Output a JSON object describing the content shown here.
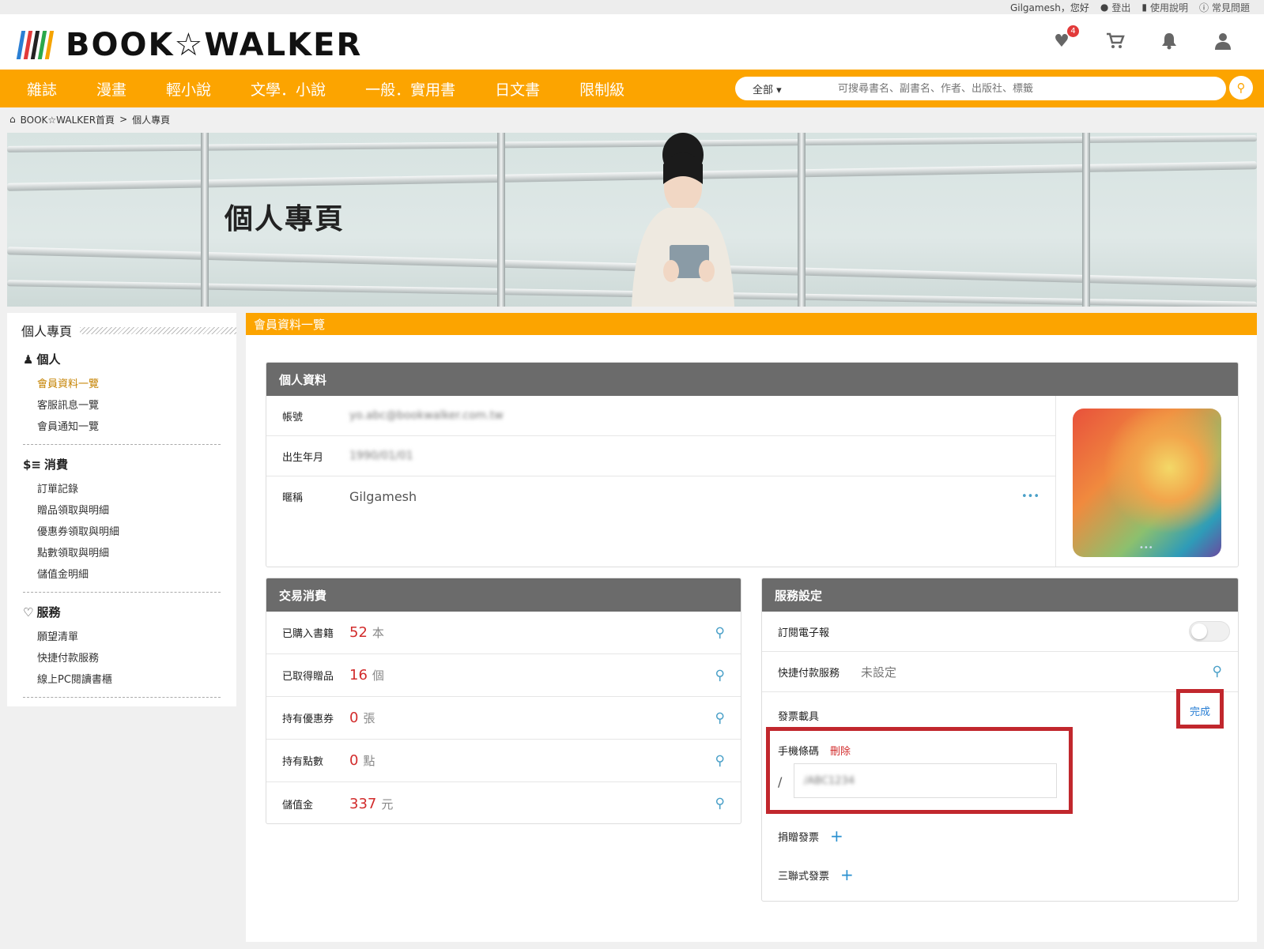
{
  "topbar": {
    "greeting": "Gilgamesh，您好",
    "logout": "登出",
    "usage": "使用說明",
    "faq": "常見問題"
  },
  "logo": {
    "text": "BOOK☆WALKER"
  },
  "header": {
    "wishlist_count": "4"
  },
  "nav": {
    "items": [
      "雜誌",
      "漫畫",
      "輕小說",
      "文學．小說",
      "一般．實用書",
      "日文書",
      "限制級"
    ]
  },
  "search": {
    "category": "全部",
    "placeholder": "可搜尋書名、副書名、作者、出版社、標籤"
  },
  "breadcrumb": {
    "home": "BOOK☆WALKER首頁",
    "sep": ">",
    "current": "個人專頁"
  },
  "banner": {
    "title": "個人專頁"
  },
  "sidebar": {
    "title": "個人專頁",
    "sections": [
      {
        "title": "個人",
        "items": [
          "會員資料一覽",
          "客服訊息一覽",
          "會員通知一覽"
        ]
      },
      {
        "title": "消費",
        "items": [
          "訂單記錄",
          "贈品領取與明細",
          "優惠券領取與明細",
          "點數領取與明細",
          "儲值金明細"
        ]
      },
      {
        "title": "服務",
        "items": [
          "願望清單",
          "快捷付款服務",
          "線上PC閱讀書櫃"
        ]
      }
    ]
  },
  "main": {
    "title": "會員資料一覽"
  },
  "profile": {
    "title": "個人資料",
    "account_label": "帳號",
    "account_value": "yo.abc@bookwalker.com.tw",
    "birth_label": "出生年月",
    "birth_value": "1990/01/01",
    "nick_label": "暱稱",
    "nick_value": "Gilgamesh",
    "more": "•••"
  },
  "transactions": {
    "title": "交易消費",
    "rows": [
      {
        "label": "已購入書籍",
        "value": "52",
        "unit": "本"
      },
      {
        "label": "已取得贈品",
        "value": "16",
        "unit": "個"
      },
      {
        "label": "持有優惠券",
        "value": "0",
        "unit": "張"
      },
      {
        "label": "持有點數",
        "value": "0",
        "unit": "點"
      },
      {
        "label": "儲值金",
        "value": "337",
        "unit": "元"
      }
    ]
  },
  "services": {
    "title": "服務設定",
    "newsletter": "訂閱電子報",
    "quickpay": "快捷付款服務",
    "quickpay_value": "未設定",
    "invoice": "發票載具",
    "done": "完成",
    "mobile_barcode": "手機條碼",
    "delete": "刪除",
    "slash": "/",
    "barcode_value": "/ABC1234",
    "donate": "捐贈發票",
    "triplicate": "三聯式發票"
  },
  "colors": {
    "accent": "#fca400",
    "card_header": "#6b6b6b",
    "number": "#d22c2c",
    "highlight": "#c1272d"
  }
}
